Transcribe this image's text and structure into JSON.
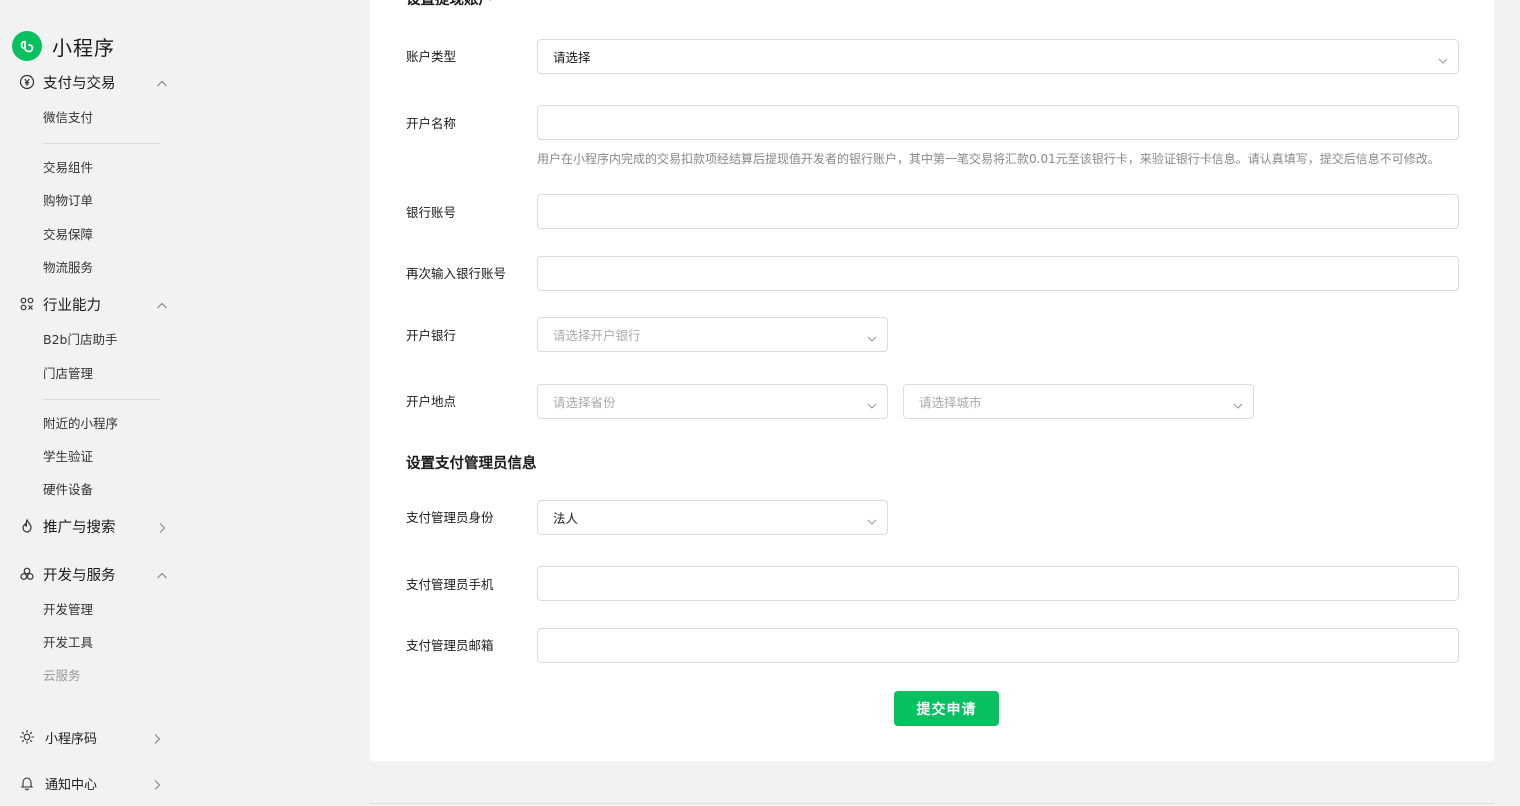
{
  "app": {
    "title": "小程序",
    "brand_color": "#07c160"
  },
  "sidebar": {
    "groups": {
      "payment": {
        "label": "支付与交易",
        "icon": "yen-circle-icon",
        "expanded": true
      },
      "industry": {
        "label": "行业能力",
        "icon": "nodes-icon",
        "expanded": true
      },
      "promotion": {
        "label": "推广与搜索",
        "icon": "flame-icon",
        "expanded": false
      },
      "dev": {
        "label": "开发与服务",
        "icon": "flower-icon",
        "expanded": true
      },
      "qrcode": {
        "label": "小程序码",
        "icon": "sun-icon",
        "expanded": false
      },
      "notify": {
        "label": "通知中心",
        "icon": "bell-icon",
        "expanded": false
      }
    },
    "items": {
      "wechat_pay": "微信支付",
      "trade_component": "交易组件",
      "shopping_order": "购物订单",
      "trade_guarantee": "交易保障",
      "logistics": "物流服务",
      "b2b_assistant": "B2b门店助手",
      "store_mgmt": "门店管理",
      "nearby": "附近的小程序",
      "student_verify": "学生验证",
      "hardware": "硬件设备",
      "dev_mgmt": "开发管理",
      "dev_tools": "开发工具",
      "cloud": "云服务"
    }
  },
  "form": {
    "section_withdraw": "设置提现账户",
    "account_type": {
      "label": "账户类型",
      "value": "请选择"
    },
    "account_name": {
      "label": "开户名称",
      "value": "",
      "hint": "用户在小程序内完成的交易扣款项经结算后提现值开发者的银行账户，其中第一笔交易将汇款0.01元至该银行卡，来验证银行卡信息。请认真填写，提交后信息不可修改。"
    },
    "bank_account": {
      "label": "银行账号",
      "value": ""
    },
    "bank_account_confirm": {
      "label": "再次输入银行账号",
      "value": ""
    },
    "bank": {
      "label": "开户银行",
      "placeholder": "请选择开户银行"
    },
    "location": {
      "label": "开户地点",
      "province_placeholder": "请选择省份",
      "city_placeholder": "请选择城市"
    },
    "section_admin": "设置支付管理员信息",
    "admin_identity": {
      "label": "支付管理员身份",
      "value": "法人"
    },
    "admin_phone": {
      "label": "支付管理员手机",
      "value": ""
    },
    "admin_email": {
      "label": "支付管理员邮箱",
      "value": ""
    },
    "submit_label": "提交申请"
  }
}
